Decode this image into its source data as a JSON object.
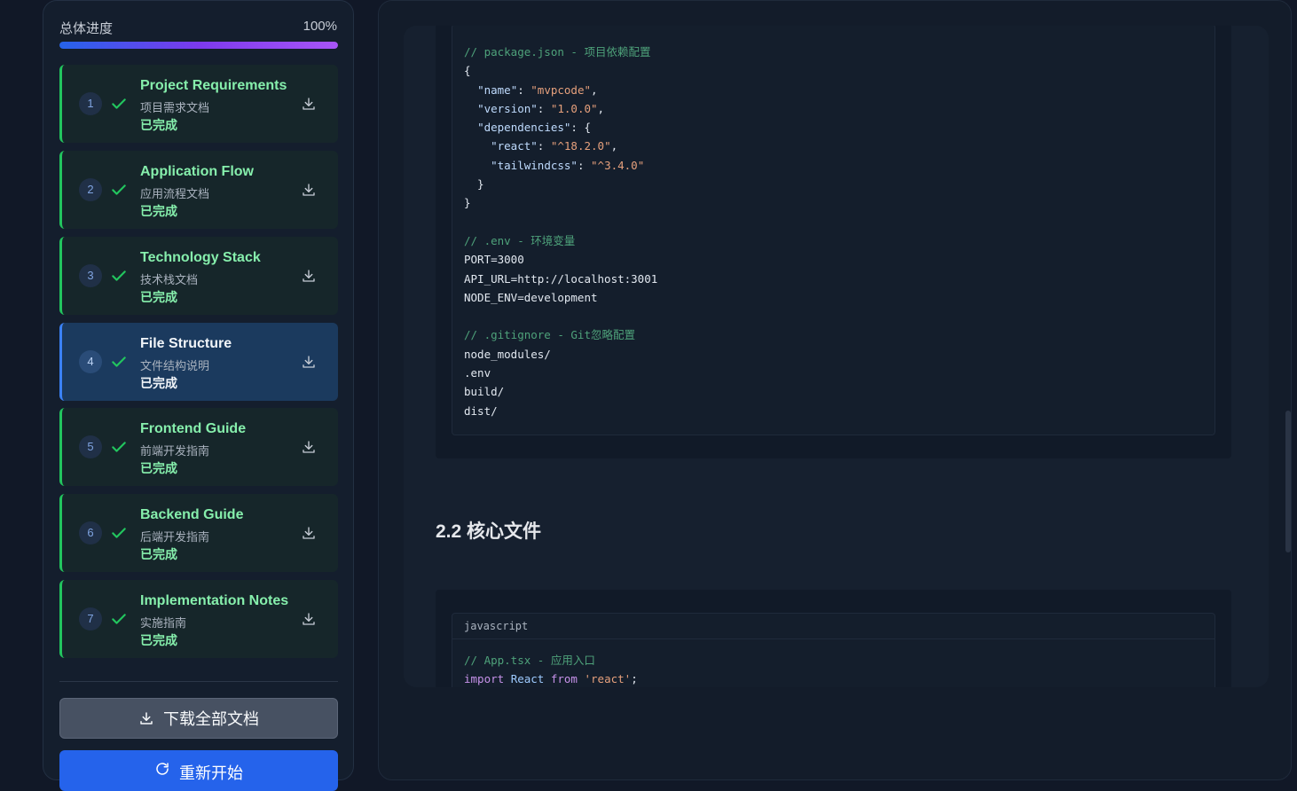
{
  "progress": {
    "label": "总体进度",
    "value": "100%",
    "fraction": 1.0
  },
  "steps": [
    {
      "num": "1",
      "title": "Project Requirements",
      "subtitle": "项目需求文档",
      "status": "已完成",
      "active": false
    },
    {
      "num": "2",
      "title": "Application Flow",
      "subtitle": "应用流程文档",
      "status": "已完成",
      "active": false
    },
    {
      "num": "3",
      "title": "Technology Stack",
      "subtitle": "技术栈文档",
      "status": "已完成",
      "active": false
    },
    {
      "num": "4",
      "title": "File Structure",
      "subtitle": "文件结构说明",
      "status": "已完成",
      "active": true
    },
    {
      "num": "5",
      "title": "Frontend Guide",
      "subtitle": "前端开发指南",
      "status": "已完成",
      "active": false
    },
    {
      "num": "6",
      "title": "Backend Guide",
      "subtitle": "后端开发指南",
      "status": "已完成",
      "active": false
    },
    {
      "num": "7",
      "title": "Implementation Notes",
      "subtitle": "实施指南",
      "status": "已完成",
      "active": false
    }
  ],
  "actions": {
    "download_all": "下载全部文档",
    "restart": "重新开始"
  },
  "icons": {
    "check": "check-icon",
    "download": "download-icon",
    "restart": "refresh-icon"
  },
  "colors": {
    "accent": "#2563eb",
    "success": "#22c55e",
    "active_step": "#1b3a5e"
  },
  "doc": {
    "heading": "2.2 核心文件",
    "code_block_1": {
      "lines": [
        "// package.json - 项目依赖配置",
        "{",
        "  \"name\": \"mvpcode\",",
        "  \"version\": \"1.0.0\",",
        "  \"dependencies\": {",
        "    \"react\": \"^18.2.0\",",
        "    \"tailwindcss\": \"^3.4.0\"",
        "  }",
        "}",
        "",
        "// .env - 环境变量",
        "PORT=3000",
        "API_URL=http://localhost:3001",
        "NODE_ENV=development",
        "",
        "// .gitignore - Git忽略配置",
        "node_modules/",
        ".env",
        "build/",
        "dist/"
      ]
    },
    "code_block_2": {
      "language": "javascript",
      "lines": [
        "// App.tsx - 应用入口",
        "import React from 'react';"
      ]
    }
  }
}
